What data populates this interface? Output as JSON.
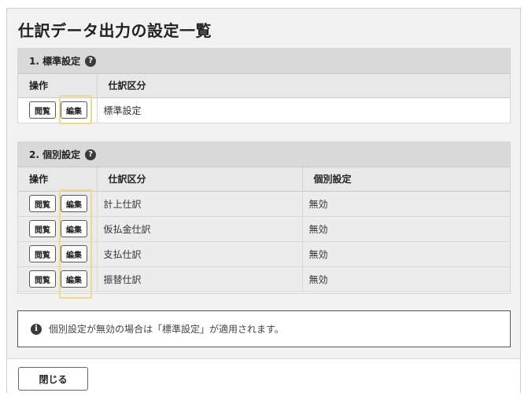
{
  "dialog": {
    "title": "仕訳データ出力の設定一覧"
  },
  "standard": {
    "heading": "1. 標準設定",
    "columns": {
      "ops": "操作",
      "category": "仕訳区分"
    },
    "rows": [
      {
        "view": "閲覧",
        "edit": "編集",
        "category": "標準設定"
      }
    ]
  },
  "individual": {
    "heading": "2. 個別設定",
    "columns": {
      "ops": "操作",
      "category": "仕訳区分",
      "setting": "個別設定"
    },
    "rows": [
      {
        "view": "閲覧",
        "edit": "編集",
        "category": "計上仕訳",
        "setting": "無効"
      },
      {
        "view": "閲覧",
        "edit": "編集",
        "category": "仮払金仕訳",
        "setting": "無効"
      },
      {
        "view": "閲覧",
        "edit": "編集",
        "category": "支払仕訳",
        "setting": "無効"
      },
      {
        "view": "閲覧",
        "edit": "編集",
        "category": "振替仕訳",
        "setting": "無効"
      }
    ]
  },
  "note": {
    "icon": "info-icon",
    "text": "個別設定が無効の場合は「標準設定」が適用されます。"
  },
  "footer": {
    "close_label": "閉じる"
  },
  "icons": {
    "help": "question-circle-icon"
  },
  "colors": {
    "highlight": "#f2d98a",
    "header_bg": "#d9d9d9"
  }
}
